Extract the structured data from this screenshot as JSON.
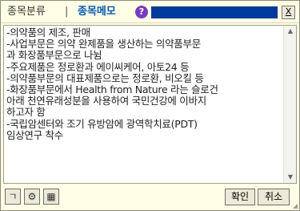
{
  "tabs": {
    "classify_label": "종목분류",
    "separator": "|",
    "memo_label": "종목메모"
  },
  "help_icon_glyph": "?",
  "close_glyph": "X",
  "memo": {
    "lines": [
      "-의약품의 제조, 판매",
      "-사업부문은 의약 완제품을 생산하는 의약품부문",
      "과 화장품부문으로 나뉨",
      "-주요제품은 정로환과 에이씨케어, 아토24 등",
      "-의약품부문의 대표제품으로는 정로환, 비오킬 등",
      "-화장품부문에서 Health from Nature 라는 슬로건",
      "아래 천연유래성분을 사용하여 국민건강에 이바지",
      "하고자 함",
      "-국립암센터와 조기 유방암에 광역학치료(PDT)",
      "임상연구 착수"
    ]
  },
  "footer": {
    "mark_glyph": "ㄱ",
    "settings_glyph": "⚙",
    "calendar_glyph": "▦",
    "ok_label": "확인",
    "cancel_label": "취소"
  },
  "colors": {
    "title_field": "#003a9c",
    "memo_tab": "#0a55b5",
    "help_icon": "#7a3cc0",
    "window_bg": "#ffffe6"
  }
}
